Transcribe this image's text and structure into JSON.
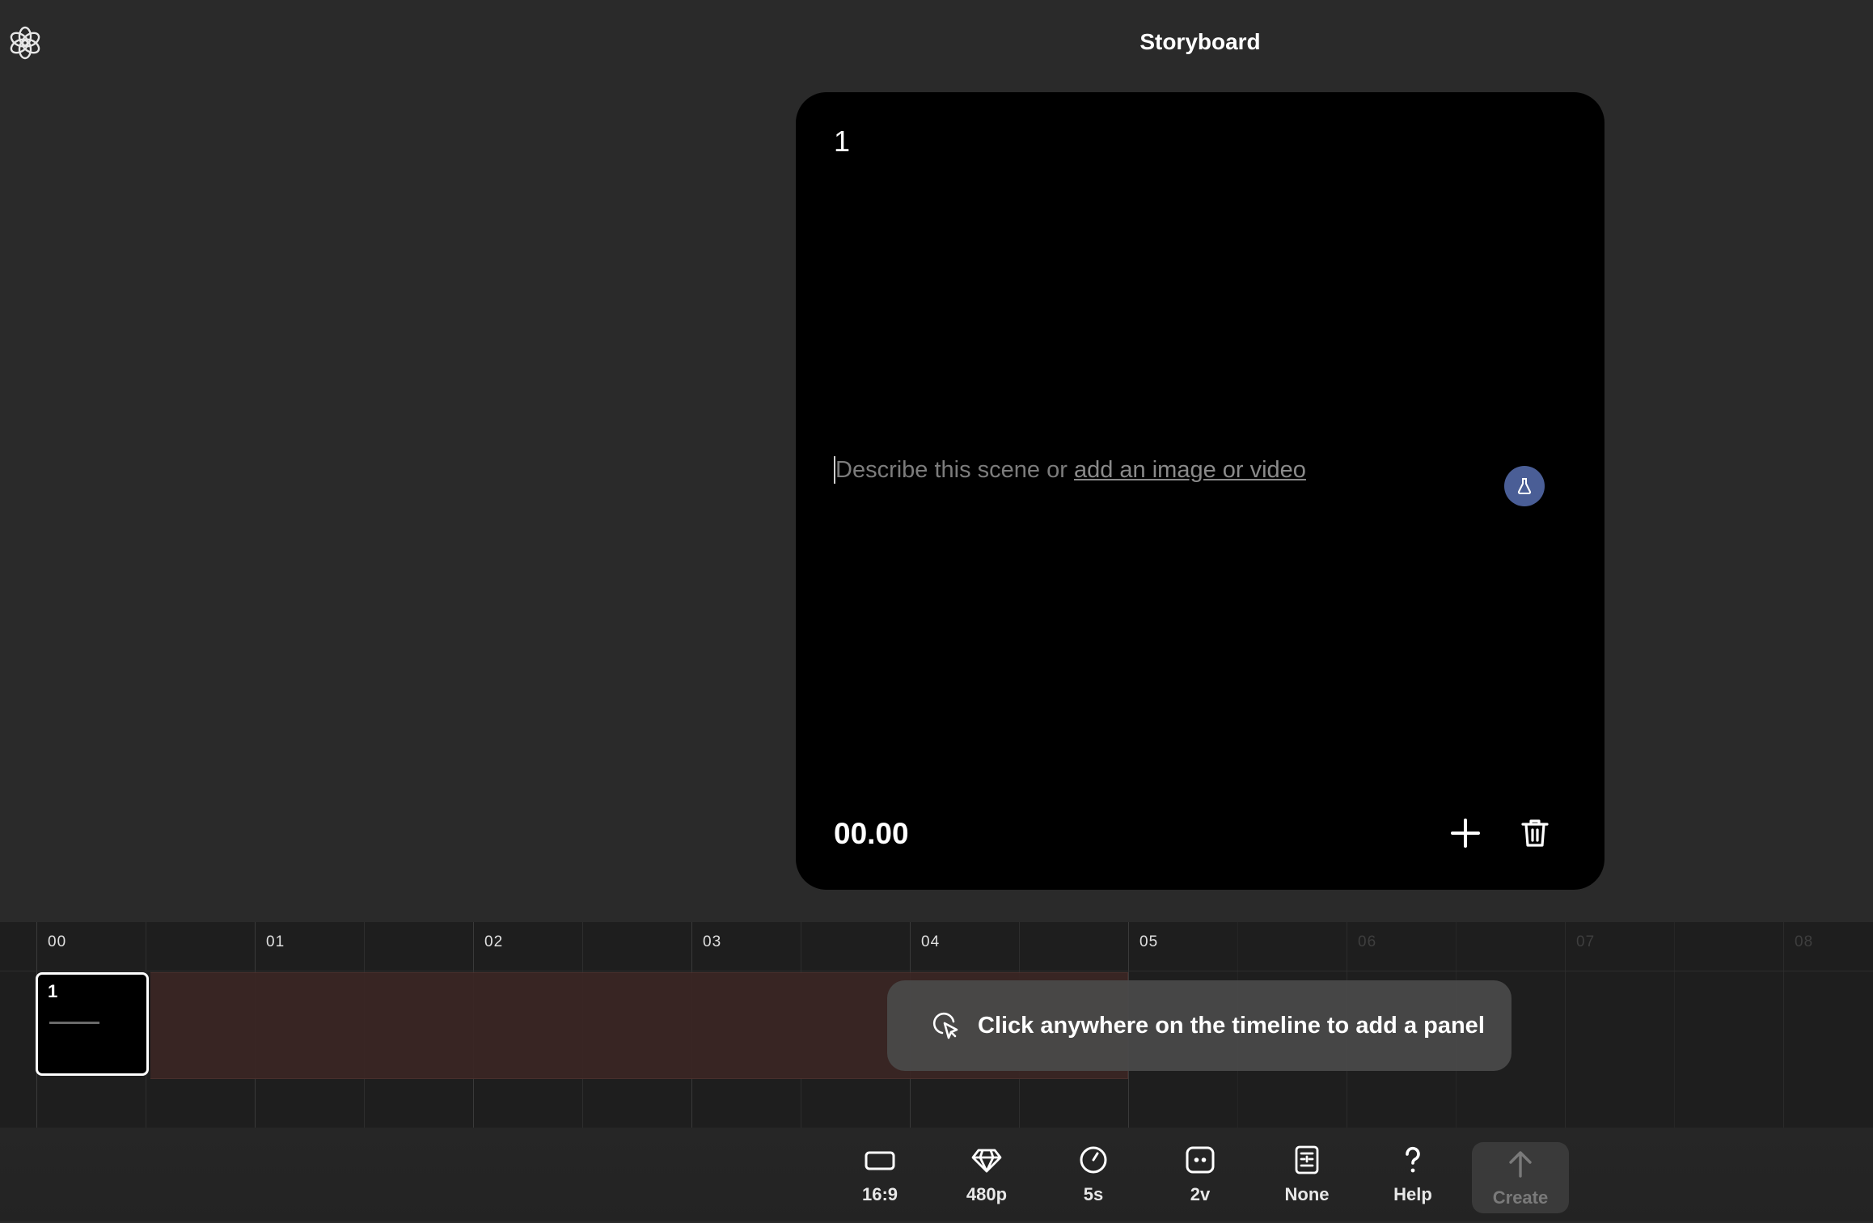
{
  "app": {
    "title": "Storyboard",
    "logo": "openai-logo-icon"
  },
  "card": {
    "index": "1",
    "prompt_text": "Describe this scene or ",
    "prompt_link": "add an image or video",
    "time": "00.00",
    "lab_button": "flask-icon",
    "add_button": "plus-icon",
    "delete_button": "trash-icon",
    "accent": "#4a5e96"
  },
  "timeline": {
    "ruler": [
      "00",
      "01",
      "02",
      "03",
      "04",
      "05",
      "06",
      "07",
      "08"
    ],
    "active_seconds": 5,
    "panel": {
      "number": "1"
    },
    "hint": "Click anywhere on the timeline to add a panel",
    "hint_icon": "cursor-click-icon"
  },
  "toolbar": {
    "items": [
      {
        "label": "16:9",
        "icon": "aspect-ratio-icon"
      },
      {
        "label": "480p",
        "icon": "diamond-icon"
      },
      {
        "label": "5s",
        "icon": "clock-icon"
      },
      {
        "label": "2v",
        "icon": "variations-icon"
      },
      {
        "label": "None",
        "icon": "preset-icon"
      },
      {
        "label": "Help",
        "icon": "question-icon"
      },
      {
        "label": "Create",
        "icon": "arrow-up-icon"
      }
    ]
  }
}
